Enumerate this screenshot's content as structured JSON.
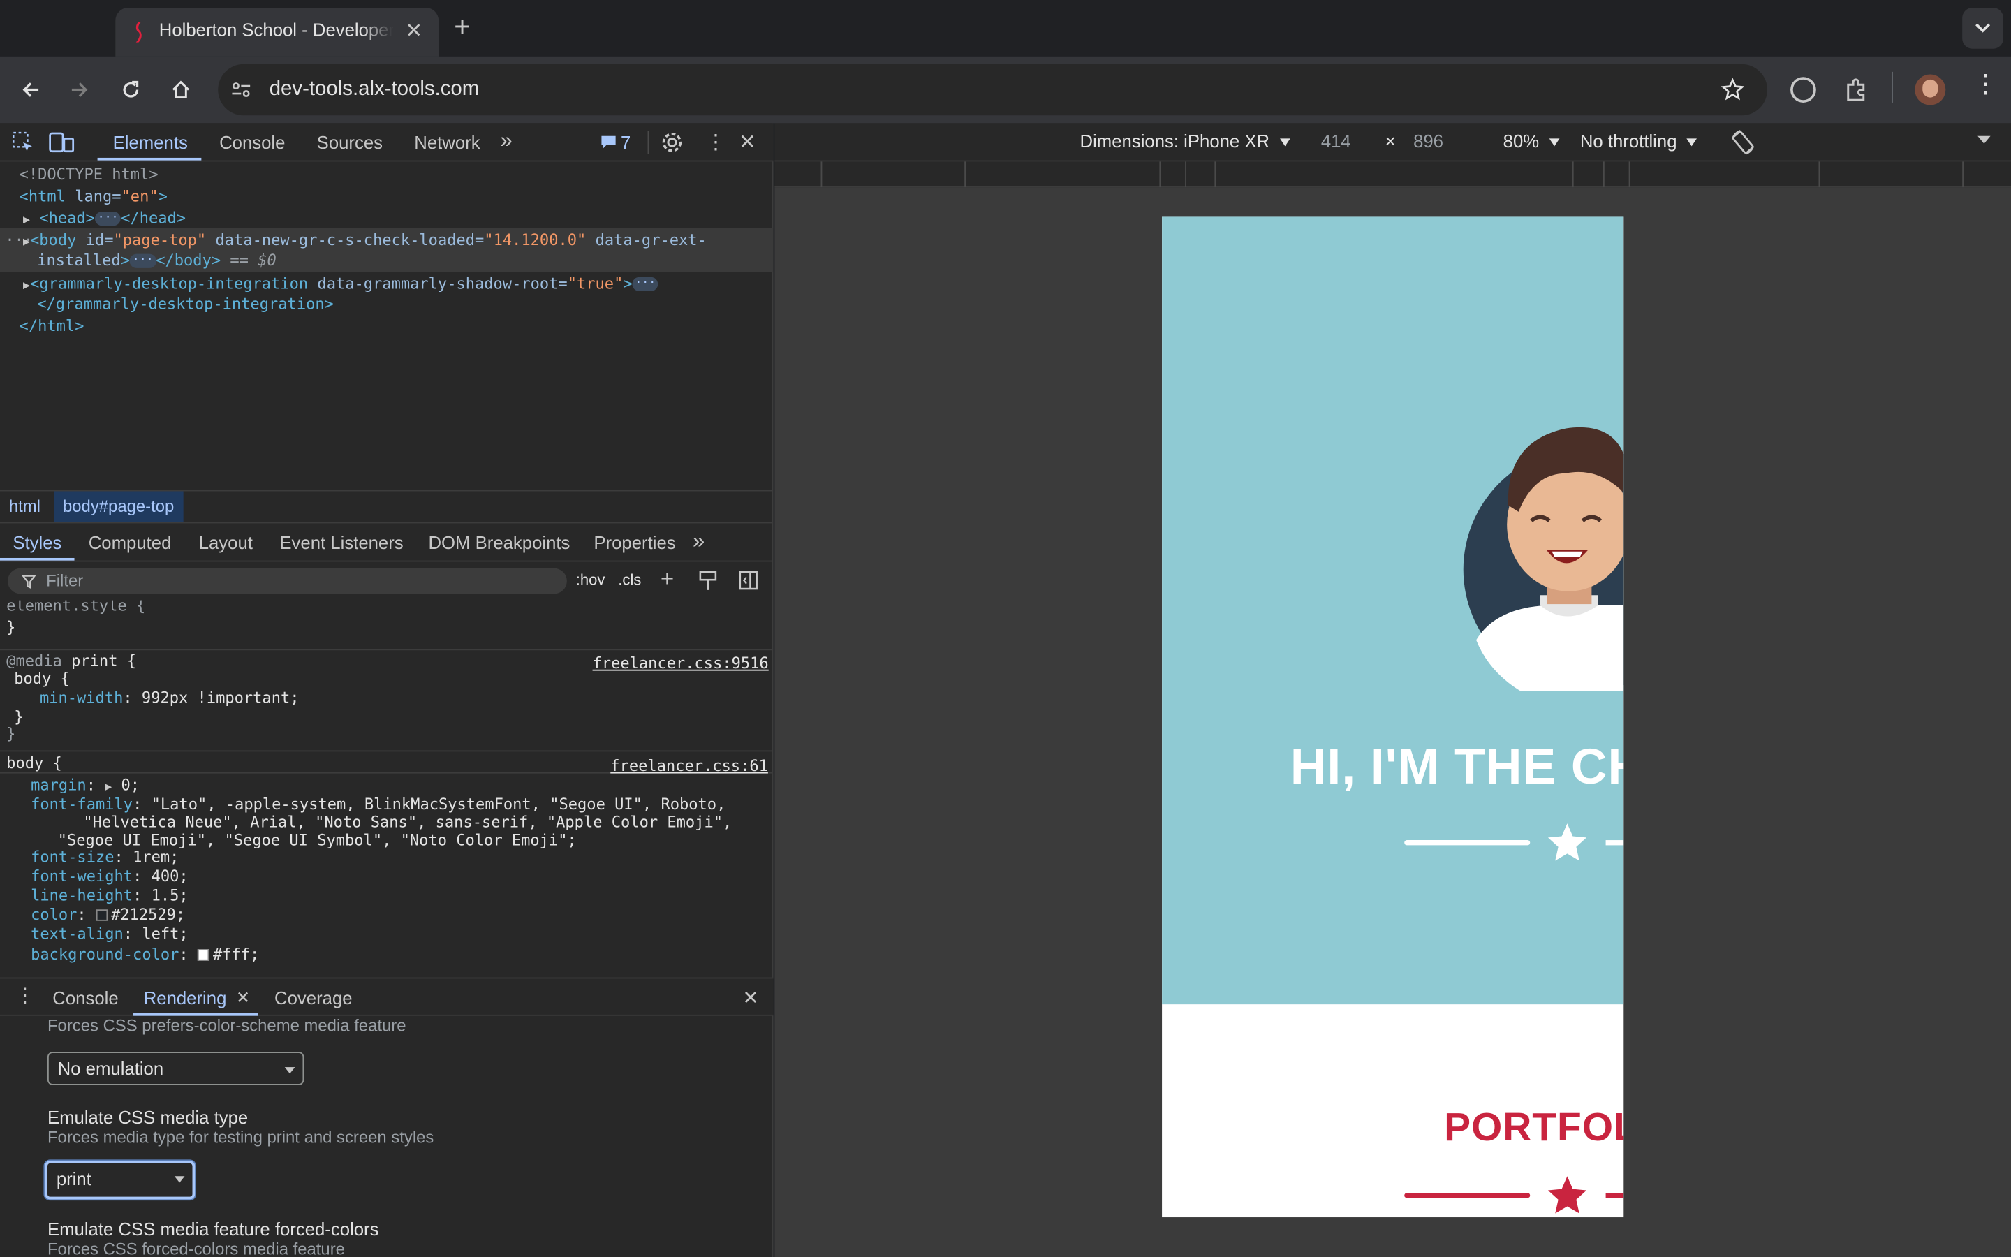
{
  "browser": {
    "tab_title": "Holberton School - Developer",
    "url": "dev-tools.alx-tools.com"
  },
  "devtools": {
    "tabs": [
      "Elements",
      "Console",
      "Sources",
      "Network"
    ],
    "issues_count": "7",
    "dom": {
      "doctype": "<!DOCTYPE html>",
      "html_open_tag": "<html",
      "html_lang_attr": "lang=",
      "html_lang_val": "\"en\"",
      "head": "<head>",
      "head_close": "</head>",
      "body_tag": "<body",
      "body_id_attr": "id=",
      "body_id_val": "\"page-top\"",
      "body_attr2": "data-new-gr-c-s-check-loaded=",
      "body_attr2_val": "\"14.1200.0\"",
      "body_attr3": "data-gr-ext-",
      "body_attr3_cont": "installed",
      "body_close": "</body>",
      "selected_marker": "== $0",
      "grammarly_tag": "<grammarly-desktop-integration",
      "grammarly_attr": "data-grammarly-shadow-root=",
      "grammarly_val": "\"true\"",
      "grammarly_close": "</grammarly-desktop-integration>",
      "html_close": "</html>"
    },
    "breadcrumbs": [
      "html",
      "body#page-top"
    ],
    "styles_tabs": [
      "Styles",
      "Computed",
      "Layout",
      "Event Listeners",
      "DOM Breakpoints",
      "Properties"
    ],
    "filter_placeholder": "Filter",
    "hov": ":hov",
    "cls": ".cls",
    "rules": {
      "element_style": "element.style {",
      "close_brace": "}",
      "media_at": "@media",
      "media_type": "print {",
      "media_body": "body {",
      "media_prop": "min-width",
      "media_value": "992px !important;",
      "media_source": "freelancer.css:9516",
      "body_selector": "body {",
      "body_source": "freelancer.css:61",
      "margin_prop": "margin",
      "margin_val": "0;",
      "font_family_prop": "font-family",
      "font_family_val1": "\"Lato\", -apple-system, BlinkMacSystemFont, \"Segoe UI\", Roboto,",
      "font_family_val2": "\"Helvetica Neue\", Arial, \"Noto Sans\", sans-serif, \"Apple Color Emoji\",",
      "font_family_val3": "\"Segoe UI Emoji\", \"Segoe UI Symbol\", \"Noto Color Emoji\";",
      "font_size_prop": "font-size",
      "font_size_val": "1rem;",
      "font_weight_prop": "font-weight",
      "font_weight_val": "400;",
      "line_height_prop": "line-height",
      "line_height_val": "1.5;",
      "color_prop": "color",
      "color_val": "#212529;",
      "text_align_prop": "text-align",
      "text_align_val": "left;",
      "bg_prop": "background-color",
      "bg_val": "#fff;"
    },
    "drawer_tabs": [
      "Console",
      "Rendering",
      "Coverage"
    ],
    "rendering": {
      "prefers_desc": "Forces CSS prefers-color-scheme media feature",
      "prefers_value": "No emulation",
      "media_type_title": "Emulate CSS media type",
      "media_type_desc": "Forces media type for testing print and screen styles",
      "media_type_value": "print",
      "forced_colors_title": "Emulate CSS media feature forced-colors",
      "forced_colors_desc": "Forces CSS forced-colors media feature"
    }
  },
  "device_toolbar": {
    "dimensions": "Dimensions: iPhone XR",
    "width": "414",
    "height": "896",
    "zoom": "80%",
    "throttling": "No throttling"
  },
  "page_preview": {
    "hero_title": "HI, I'M THE CHATBOT",
    "portfolio_title": "PORTFOLIO",
    "colors": {
      "masthead": "#8fcad3",
      "accent": "#c9243f"
    }
  }
}
